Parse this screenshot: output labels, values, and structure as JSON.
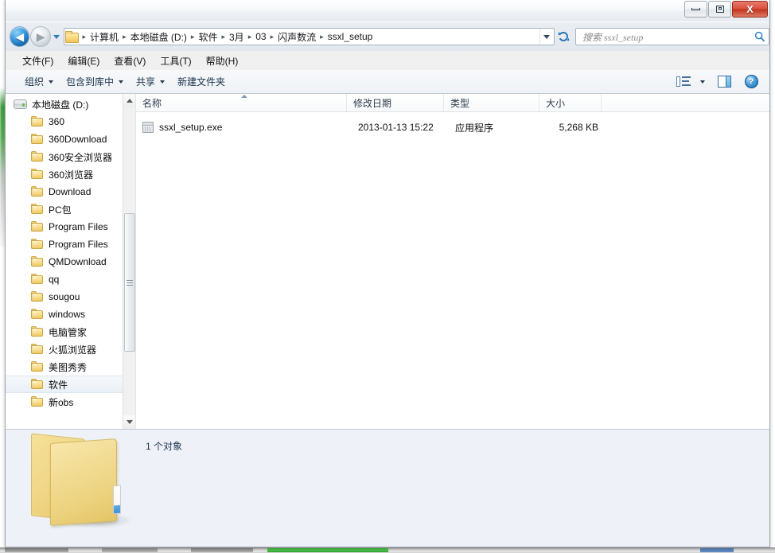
{
  "window": {
    "controls": {
      "minimize": "−",
      "maximize": "□",
      "close": "X"
    }
  },
  "address": {
    "back_arrow": "◀",
    "forward_arrow": "▶",
    "crumbs": [
      "计算机",
      "本地磁盘 (D:)",
      "软件",
      "3月",
      "03",
      "闪声数流",
      "ssxl_setup"
    ],
    "separator": "▸",
    "refresh_icon": "↻",
    "dropdown_icon": "▾"
  },
  "search": {
    "placeholder": "搜索 ssxl_setup",
    "value": "",
    "icon": "search-icon"
  },
  "menu": {
    "items": [
      "文件(F)",
      "编辑(E)",
      "查看(V)",
      "工具(T)",
      "帮助(H)"
    ]
  },
  "toolbar": {
    "items": [
      {
        "label": "组织",
        "has_caret": true
      },
      {
        "label": "包含到库中",
        "has_caret": true
      },
      {
        "label": "共享",
        "has_caret": true
      },
      {
        "label": "新建文件夹",
        "has_caret": false
      }
    ],
    "right_icons": [
      "view-list-icon",
      "view-caret-icon",
      "preview-pane-icon",
      "help-icon"
    ],
    "help_glyph": "?"
  },
  "sidebar": {
    "root": {
      "label": "本地磁盘 (D:)",
      "icon": "drive-icon"
    },
    "items": [
      {
        "label": "360",
        "selected": false
      },
      {
        "label": "360Download",
        "selected": false
      },
      {
        "label": "360安全浏览器",
        "selected": false
      },
      {
        "label": "360浏览器",
        "selected": false
      },
      {
        "label": "Download",
        "selected": false
      },
      {
        "label": "PC包",
        "selected": false
      },
      {
        "label": "Program Files",
        "selected": false
      },
      {
        "label": "Program Files",
        "selected": false
      },
      {
        "label": "QMDownload",
        "selected": false
      },
      {
        "label": "qq",
        "selected": false
      },
      {
        "label": "sougou",
        "selected": false
      },
      {
        "label": "windows",
        "selected": false
      },
      {
        "label": "电脑管家",
        "selected": false
      },
      {
        "label": "火狐浏览器",
        "selected": false
      },
      {
        "label": "美图秀秀",
        "selected": false
      },
      {
        "label": "软件",
        "selected": true
      },
      {
        "label": "新obs",
        "selected": false
      }
    ],
    "scroll": {
      "up_arrow": "▲",
      "down_arrow": "▼"
    }
  },
  "filelist": {
    "columns": [
      {
        "key": "name",
        "label": "名称",
        "sorted": true
      },
      {
        "key": "date",
        "label": "修改日期",
        "sorted": false
      },
      {
        "key": "type",
        "label": "类型",
        "sorted": false
      },
      {
        "key": "size",
        "label": "大小",
        "sorted": false
      }
    ],
    "rows": [
      {
        "name": "ssxl_setup.exe",
        "date": "2013-01-13 15:22",
        "type": "应用程序",
        "size": "5,268 KB",
        "icon": "executable-icon"
      }
    ]
  },
  "details": {
    "status": "1 个对象",
    "folder_icon": "folder-icon-large"
  }
}
